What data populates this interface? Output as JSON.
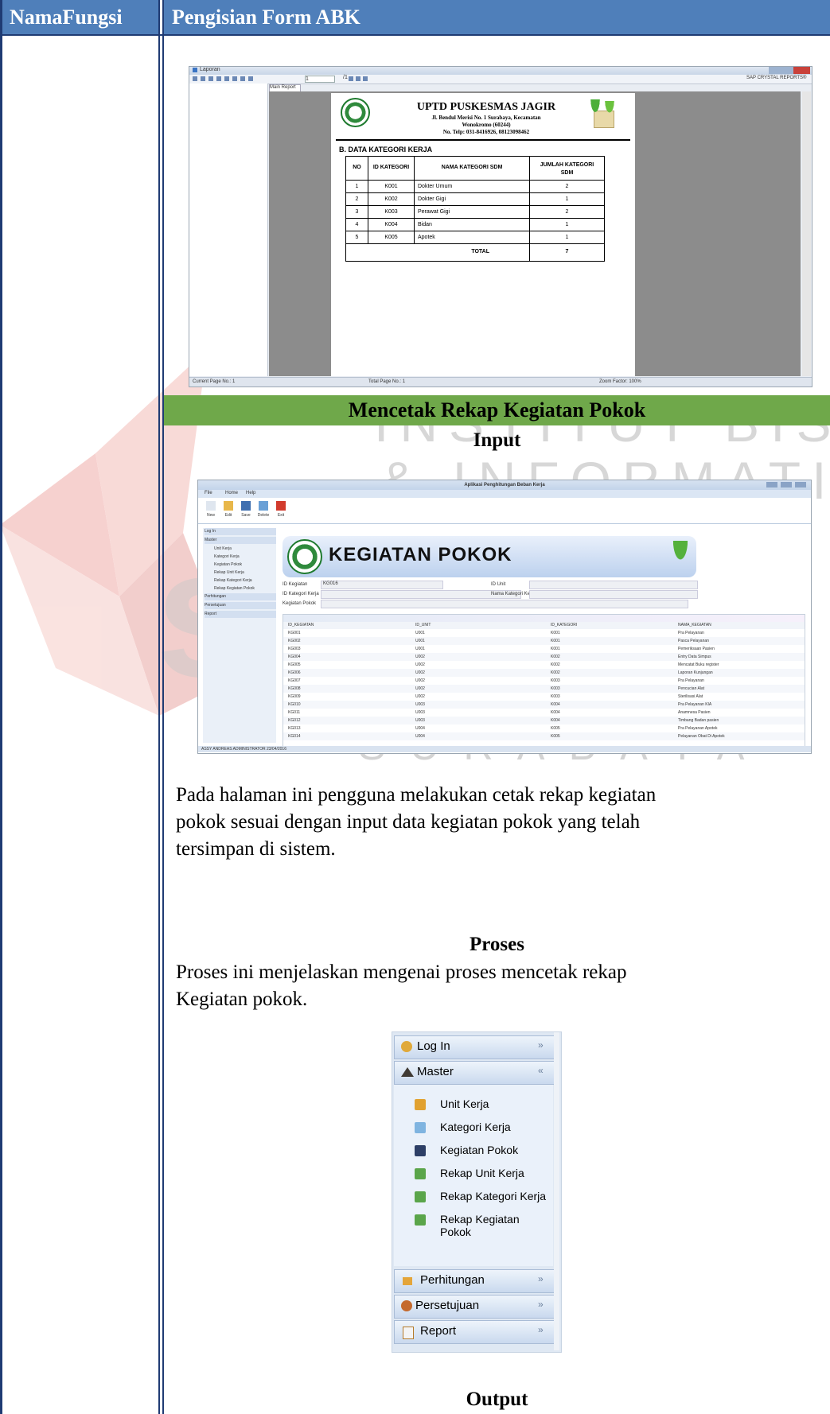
{
  "header": {
    "col1": "NamaFungsi",
    "col2": "Pengisian Form ABK"
  },
  "section_title": "Mencetak Rekap Kegiatan Pokok",
  "watermark": {
    "line1": "INSTITUT BISNIS",
    "line2": "& INFORMATIKA",
    "brand": "stikom",
    "city": "SURABAYA"
  },
  "report_window": {
    "title": "Laporan",
    "page_box": "1",
    "page_of": "/1",
    "brand": "SAP CRYSTAL REPORTS®",
    "tab": "Main Report",
    "org_name": "UPTD PUSKESMAS JAGIR",
    "address1": "Jl. Bendul Merisi No. 1 Surabaya, Kecamatan",
    "address2": "Wonokromo (60244)",
    "phone": "No. Telp: 031-8416926, 08123098462",
    "section": "B. DATA KATEGORI KERJA",
    "columns": [
      "NO",
      "ID KATEGORI",
      "NAMA KATEGORI SDM",
      "JUMLAH KATEGORI SDM"
    ],
    "rows": [
      [
        "1",
        "K001",
        "Dokter Umum",
        "2"
      ],
      [
        "2",
        "K002",
        "Dokter Gigi",
        "1"
      ],
      [
        "3",
        "K003",
        "Perawat Gigi",
        "2"
      ],
      [
        "4",
        "K004",
        "Bidan",
        "1"
      ],
      [
        "5",
        "K005",
        "Apotek",
        "1"
      ]
    ],
    "total_label": "TOTAL",
    "total_value": "7",
    "status_current": "Current Page No.: 1",
    "status_total": "Total Page No.: 1",
    "status_zoom": "Zoom Factor: 100%"
  },
  "input_label": "Input",
  "app_window": {
    "title": "Aplikasi Penghitungan Beban Kerja",
    "tabs": [
      "File",
      "Home",
      "Help"
    ],
    "ribbon": [
      "New",
      "Edit",
      "Save",
      "Delete",
      "Exit"
    ],
    "nav_groups": [
      "Log In",
      "Master",
      "Perhitungan",
      "Persetujuan",
      "Report"
    ],
    "nav_items": [
      "Unit Kerja",
      "Kategori Kerja",
      "Kegiatan Pokok",
      "Rekap Unit Kerja",
      "Rekap Kategori Kerja",
      "Rekap Kegiatan Pokok"
    ],
    "banner": "KEGIATAN POKOK",
    "field_id": "ID Kegiatan",
    "field_id_value": "KG016",
    "field_kategori": "ID Kategori Kerja",
    "field_kegiatan": "Kegiatan Pokok",
    "field_unit": "ID Unit",
    "field_nama_kategori": "Nama Kategori Kerja",
    "grid_headers": [
      "ID_KEGIATAN",
      "ID_UNIT",
      "ID_KATEGORI",
      "NAMA_KEGIATAN"
    ],
    "grid_rows": [
      [
        "KG001",
        "U001",
        "K001",
        "Pra Pelayanan"
      ],
      [
        "KG002",
        "U001",
        "K001",
        "Pasca Pelayanan"
      ],
      [
        "KG003",
        "U001",
        "K001",
        "Pemeriksaan Pasien"
      ],
      [
        "KG004",
        "U002",
        "K002",
        "Entry Data Simpus"
      ],
      [
        "KG005",
        "U002",
        "K002",
        "Mencatat Buku register"
      ],
      [
        "KG006",
        "U002",
        "K002",
        "Laporan Kunjungan"
      ],
      [
        "KG007",
        "U002",
        "K003",
        "Pra Pelayanan"
      ],
      [
        "KG008",
        "U002",
        "K003",
        "Pencucian Alat"
      ],
      [
        "KG009",
        "U002",
        "K003",
        "Sterilisasi Alat"
      ],
      [
        "KG010",
        "U003",
        "K004",
        "Pra Pelayanan KIA"
      ],
      [
        "KG011",
        "U003",
        "K004",
        "Anamnesa Pasien"
      ],
      [
        "KG012",
        "U003",
        "K004",
        "Timbang Badan pasien"
      ],
      [
        "KG013",
        "U004",
        "K005",
        "Pra Pelayanan Apotek"
      ],
      [
        "KG014",
        "U004",
        "K005",
        "Pelayanan Obat Di Apotek"
      ]
    ],
    "status": "ASSY ANDREAS ADMINISTRATOR 23/04/2016"
  },
  "paragraph1": "Pada halaman ini pengguna melakukan cetak rekap kegiatan pokok sesuai dengan input data kegiatan pokok yang telah tersimpan di sistem.",
  "paragraph1_lines": [
    "Pada halaman ini pengguna melakukan cetak rekap kegiatan",
    "pokok sesuai dengan input data kegiatan pokok yang telah",
    "tersimpan di sistem."
  ],
  "proses_label": "Proses",
  "paragraph2_lines": [
    "Proses ini menjelaskan mengenai proses mencetak rekap",
    "Kegiatan pokok."
  ],
  "menu": {
    "login": "Log In",
    "master": "Master",
    "items": [
      "Unit Kerja",
      "Kategori Kerja",
      "Kegiatan Pokok",
      "Rekap Unit Kerja",
      "Rekap Kategori Kerja",
      "Rekap Kegiatan Pokok"
    ],
    "perhitungan": "Perhitungan",
    "persetujuan": "Persetujuan",
    "report": "Report"
  },
  "output_label": "Output",
  "colors": {
    "header_blue": "#4f7fba",
    "section_green": "#6fa84a",
    "frame": "#1f3b73"
  }
}
